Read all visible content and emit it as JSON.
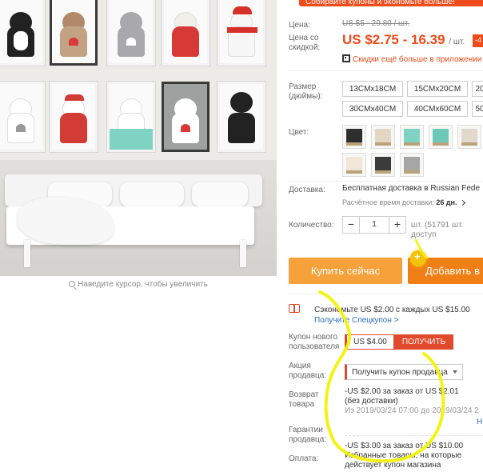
{
  "promo_banner": "Собирайте купоны и экономьте больше!",
  "price": {
    "label": "Цена:",
    "old": "US $5 - 29.80 / шт.",
    "discount_label": "Цена со скидкой:",
    "current": "US $2.75 - 16.39",
    "unit": "/ шт.",
    "badge": "-4",
    "app_discount": "Скидки ещё больше в приложении"
  },
  "size": {
    "label": "Размер (дюймы):",
    "options": [
      "13CMx18CM",
      "15CMx20CM",
      "20",
      "30CMx40CM",
      "40CMx60CM",
      "50"
    ]
  },
  "color": {
    "label": "Цвет:"
  },
  "shipping": {
    "label": "Доставка:",
    "main": "Бесплатная доставка в Russian Fede",
    "estimate_label": "Расчётное время доставки:",
    "estimate_value": "26 дн."
  },
  "quantity": {
    "label": "Количество:",
    "minus": "−",
    "value": "1",
    "plus": "+",
    "note": "шт. (51791 шт. доступ"
  },
  "buttons": {
    "buy_now": "Купить сейчас",
    "add_to_cart": "Добавить в"
  },
  "savings": {
    "text": "Сэкономьте US $2.00 с каждых US $15.00",
    "link": "Получите Спецкупон >"
  },
  "new_user_coupon": {
    "label": "Купон нового пользователя",
    "value": "US $4.00",
    "button": "ПОЛУЧИТЬ"
  },
  "store_promo": {
    "label": "Акция продавца:",
    "select": "Получить купон продавца"
  },
  "returns": {
    "label": "Возврат товара"
  },
  "guarantee": {
    "label": "Гарантии продавца:"
  },
  "payment": {
    "label": "Оплата:"
  },
  "offers": [
    {
      "line1": "-US $2.00 за заказ от US $2.01",
      "line2": "(без доставки)",
      "dates": "Из 2019/03/24 07:00 до 2019/03/24 2"
    },
    {
      "line1": "-US $3.00 за заказ от US $10.00",
      "line2": "Избранные товары, на которые",
      "line3": "действует купон магазина"
    }
  ],
  "offer_edge_link": "Н",
  "zoom_hint": "Наведите курсор, чтобы увеличить",
  "colors": {
    "accent": "#f04b1a",
    "buy": "#f6a13a",
    "cart": "#f07f16",
    "link": "#2a6dc6",
    "marker": "#f2f20a"
  }
}
